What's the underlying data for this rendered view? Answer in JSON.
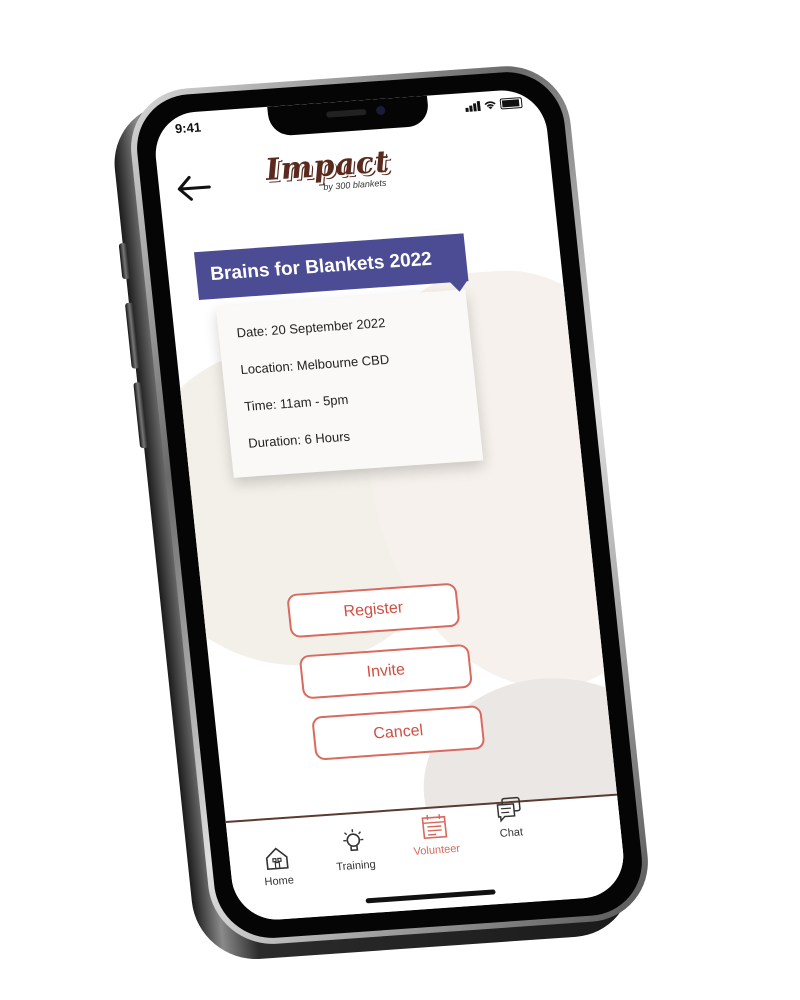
{
  "status_bar": {
    "time": "9:41"
  },
  "header": {
    "logo_text": "Impact",
    "logo_sub": "by 300 blankets"
  },
  "event": {
    "title": "Brains for Blankets 2022",
    "details": [
      "Date: 20 September 2022",
      "Location: Melbourne CBD",
      "Time: 11am - 5pm",
      "Duration: 6 Hours"
    ]
  },
  "actions": {
    "register": "Register",
    "invite": "Invite",
    "cancel": "Cancel"
  },
  "tabs": [
    {
      "label": "Home",
      "icon": "home-icon",
      "active": false
    },
    {
      "label": "Training",
      "icon": "lightbulb-icon",
      "active": false
    },
    {
      "label": "Volunteer",
      "icon": "calendar-icon",
      "active": true
    },
    {
      "label": "Chat",
      "icon": "chat-icon",
      "active": false
    }
  ],
  "colors": {
    "banner": "#4c4c95",
    "accent": "#d96a5e",
    "logo": "#5a2a1e"
  }
}
